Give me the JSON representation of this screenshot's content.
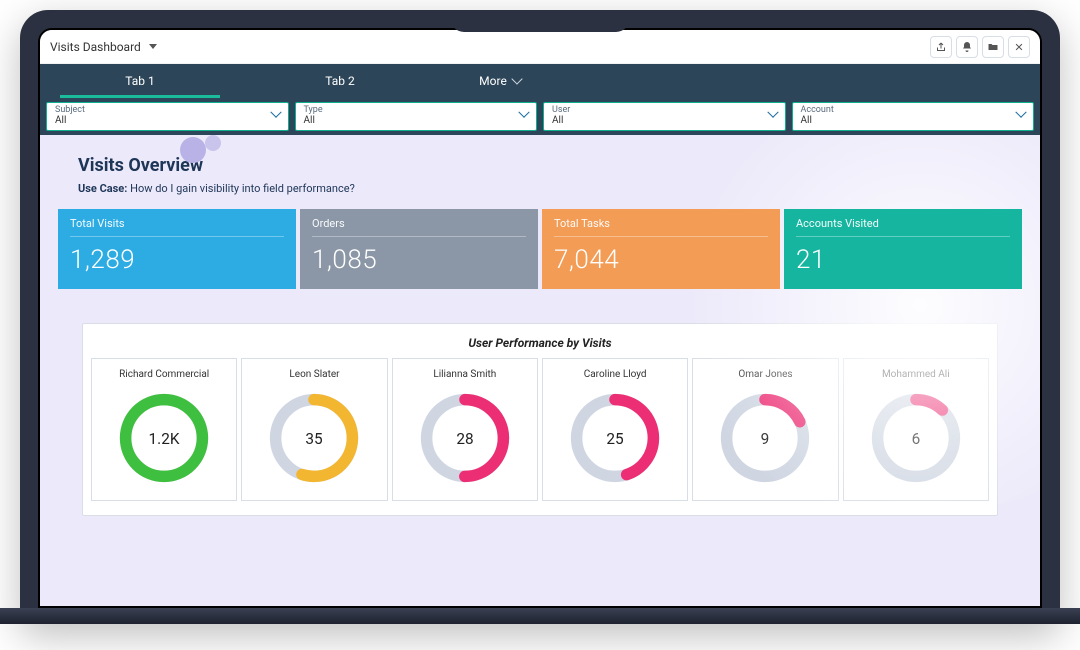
{
  "titlebar": {
    "title": "Visits Dashboard",
    "actions": [
      "share",
      "bell",
      "folder",
      "close"
    ]
  },
  "tabs": {
    "items": [
      {
        "label": "Tab 1",
        "active": true
      },
      {
        "label": "Tab 2",
        "active": false
      },
      {
        "label": "More",
        "active": false,
        "isMore": true
      }
    ]
  },
  "filters": [
    {
      "label": "Subject",
      "value": "All"
    },
    {
      "label": "Type",
      "value": "All"
    },
    {
      "label": "User",
      "value": "All"
    },
    {
      "label": "Account",
      "value": "All"
    }
  ],
  "hero": {
    "title": "Visits Overview",
    "usecase_label": "Use Case:",
    "usecase_text": "How do I gain visibility into field performance?"
  },
  "kpis": [
    {
      "label": "Total Visits",
      "value": "1,289",
      "color": "blue"
    },
    {
      "label": "Orders",
      "value": "1,085",
      "color": "gray"
    },
    {
      "label": "Total Tasks",
      "value": "7,044",
      "color": "orange"
    },
    {
      "label": "Accounts Visited",
      "value": "21",
      "color": "teal"
    }
  ],
  "donut_panel": {
    "title": "User Performance by Visits"
  },
  "chart_data": {
    "type": "donut-multiples",
    "metric": "Visits",
    "max_reference": 1200,
    "series": [
      {
        "name": "Richard Commercial",
        "display": "1.2K",
        "value": 1200,
        "pct": 100,
        "color": "#3fbf3f"
      },
      {
        "name": "Leon Slater",
        "display": "35",
        "value": 35,
        "pct": 55,
        "color": "#f2b631"
      },
      {
        "name": "Lilianna Smith",
        "display": "28",
        "value": 28,
        "pct": 50,
        "color": "#ec2f74"
      },
      {
        "name": "Caroline Lloyd",
        "display": "25",
        "value": 25,
        "pct": 45,
        "color": "#ec2f74"
      },
      {
        "name": "Omar Jones",
        "display": "9",
        "value": 9,
        "pct": 18,
        "color": "#ec2f74"
      },
      {
        "name": "Mohammed Ali",
        "display": "6",
        "value": 6,
        "pct": 12,
        "color": "#ec2f74"
      }
    ]
  }
}
